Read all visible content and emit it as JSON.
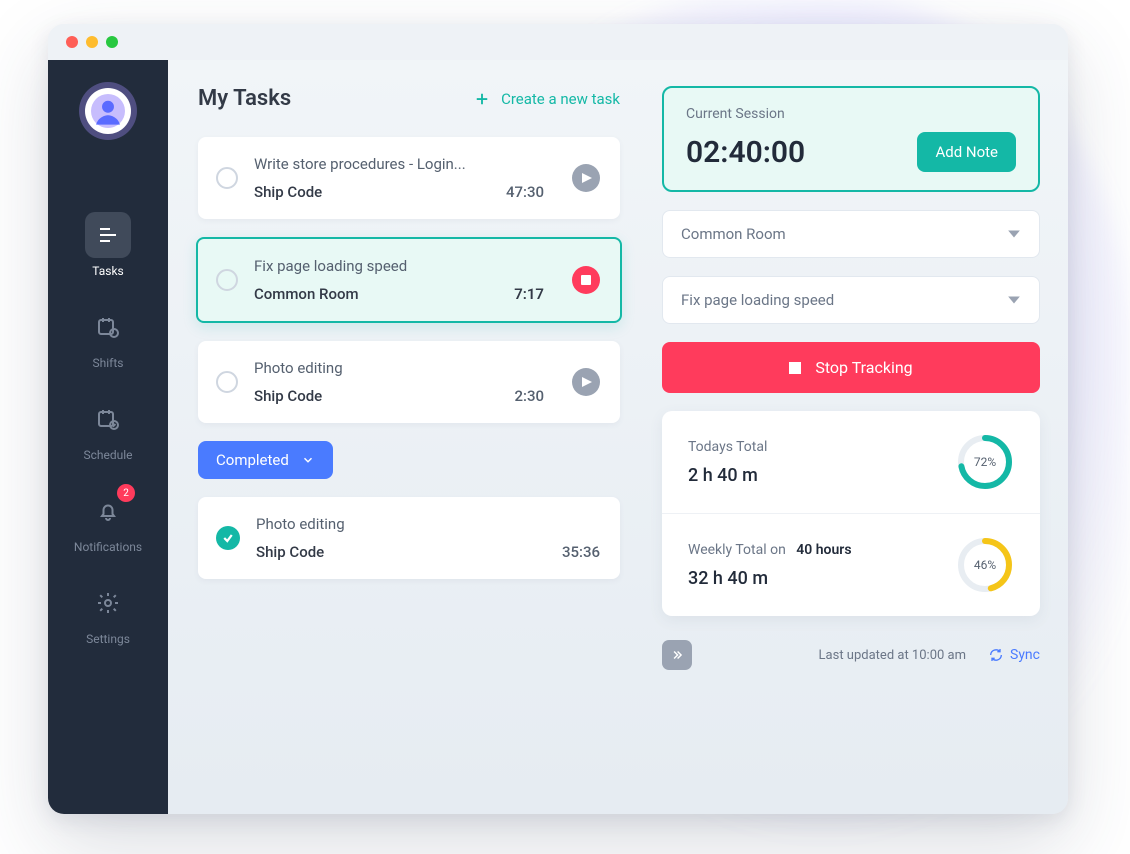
{
  "sidebar": {
    "items": [
      {
        "label": "Tasks"
      },
      {
        "label": "Shifts"
      },
      {
        "label": "Schedule"
      },
      {
        "label": "Notifications",
        "badge": "2"
      },
      {
        "label": "Settings"
      }
    ]
  },
  "tasks_header": {
    "title": "My Tasks",
    "create_label": "Create a new task"
  },
  "open_tasks": [
    {
      "title": "Write store procedures - Login...",
      "project": "Ship Code",
      "time": "47:30"
    },
    {
      "title": "Fix page loading speed",
      "project": "Common Room",
      "time": "7:17"
    },
    {
      "title": "Photo editing",
      "project": "Ship Code",
      "time": "2:30"
    }
  ],
  "completed_label": "Completed",
  "completed_tasks": [
    {
      "title": "Photo editing",
      "project": "Ship Code",
      "time": "35:36"
    }
  ],
  "session": {
    "label": "Current Session",
    "time": "02:40:00",
    "add_note": "Add Note"
  },
  "selects": {
    "project": "Common Room",
    "task": "Fix page loading speed"
  },
  "stop_tracking": "Stop Tracking",
  "totals": {
    "today_label": "Todays Total",
    "today_value": "2 h 40 m",
    "today_pct": "72%",
    "weekly_label_1": "Weekly Total on",
    "weekly_label_2": "40 hours",
    "weekly_value": "32 h 40 m",
    "weekly_pct": "46%"
  },
  "footer": {
    "updated": "Last updated at 10:00 am",
    "sync": "Sync"
  },
  "colors": {
    "teal": "#14b8a6",
    "red": "#ff3b5c",
    "blue": "#4a7bff",
    "yellow": "#f5c518"
  }
}
